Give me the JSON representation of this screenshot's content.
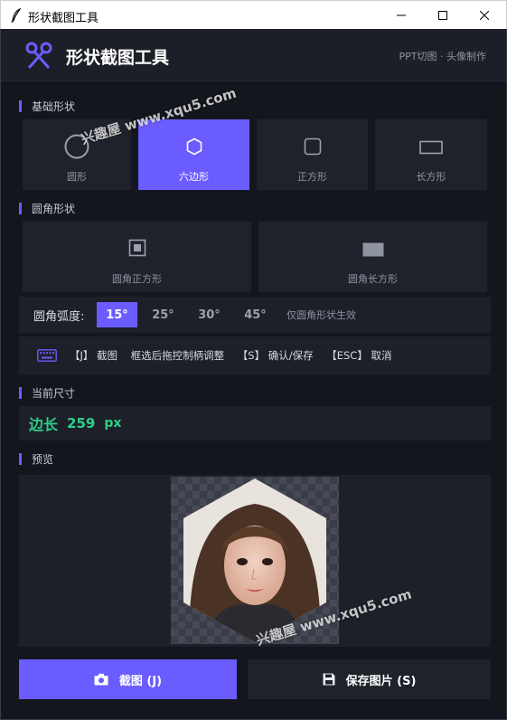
{
  "window": {
    "title": "形状截图工具"
  },
  "header": {
    "title": "形状截图工具",
    "subtitle": "PPT切图 · 头像制作"
  },
  "sections": {
    "basic": "基础形状",
    "rounded": "圆角形状",
    "size": "当前尺寸",
    "preview": "预览"
  },
  "basic_shapes": [
    {
      "label": "圆形",
      "icon": "circle-icon",
      "active": false
    },
    {
      "label": "六边形",
      "icon": "hexagon-icon",
      "active": true
    },
    {
      "label": "正方形",
      "icon": "square-icon",
      "active": false
    },
    {
      "label": "长方形",
      "icon": "rectangle-icon",
      "active": false
    }
  ],
  "rounded_shapes": [
    {
      "label": "圆角正方形",
      "icon": "rounded-square-icon"
    },
    {
      "label": "圆角长方形",
      "icon": "rounded-rectangle-icon"
    }
  ],
  "radius": {
    "label": "圆角弧度:",
    "options": [
      "15°",
      "25°",
      "30°",
      "45°"
    ],
    "selected": "15°",
    "note": "仅圆角形状生效"
  },
  "shortcuts": {
    "text": "【J】 截图    框选后拖控制柄调整    【S】 确认/保存    【ESC】 取消"
  },
  "size": {
    "label": "边长",
    "value": "259",
    "unit": "px"
  },
  "watermark": "兴趣屋 www.xqu5.com",
  "buttons": {
    "capture": "截图 (J)",
    "save": "保存图片 (S)"
  },
  "colors": {
    "accent": "#6b5cff",
    "success": "#2ecf8a",
    "background": "#14161d",
    "panel": "#1d2029"
  }
}
